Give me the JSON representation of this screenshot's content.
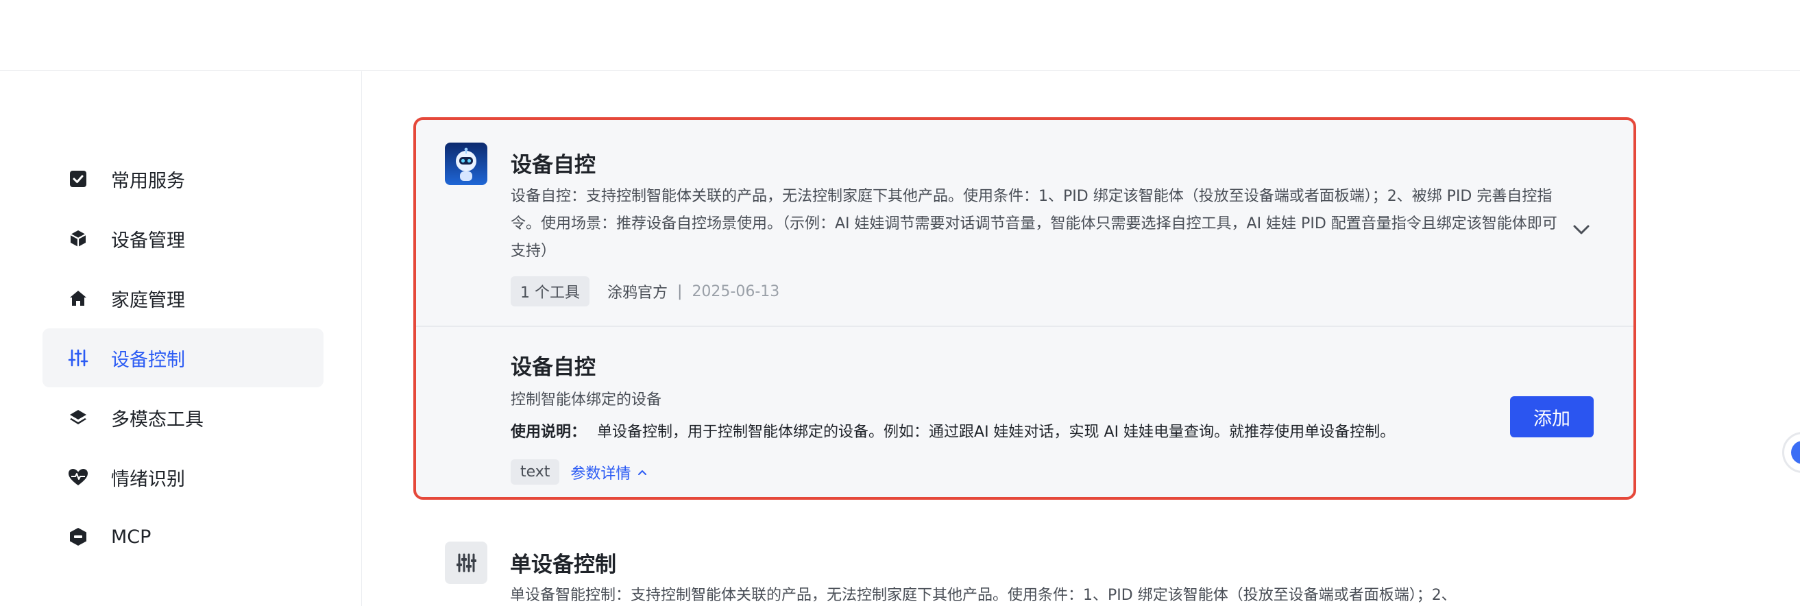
{
  "sidebar": {
    "items": [
      {
        "label": "常用服务",
        "icon": "checkbox-icon"
      },
      {
        "label": "设备管理",
        "icon": "cube-icon"
      },
      {
        "label": "家庭管理",
        "icon": "home-icon"
      },
      {
        "label": "设备控制",
        "icon": "sliders-icon",
        "active": true
      },
      {
        "label": "多模态工具",
        "icon": "layers-icon"
      },
      {
        "label": "情绪识别",
        "icon": "heart-pulse-icon"
      },
      {
        "label": "MCP",
        "icon": "mcp-icon"
      }
    ]
  },
  "card": {
    "title": "设备自控",
    "description": "设备自控：支持控制智能体关联的产品，无法控制家庭下其他产品。使用条件：1、PID 绑定该智能体（投放至设备端或者面板端）；2、被绑 PID 完善自控指令。使用场景：推荐设备自控场景使用。（示例：AI 娃娃调节需要对话调节音量，智能体只需要选择自控工具，AI 娃娃 PID 配置音量指令且绑定该智能体即可支持）",
    "tool_count": "1 个工具",
    "author": "涂鸦官方",
    "separator": "|",
    "date": "2025-06-13",
    "tool": {
      "name": "设备自控",
      "subtitle": "控制智能体绑定的设备",
      "usage_label": "使用说明：",
      "usage_text": "单设备控制，用于控制智能体绑定的设备。例如：通过跟AI 娃娃对话，实现 AI 娃娃电量查询。就推荐使用单设备控制。",
      "type_tag": "text",
      "param_link": "参数详情",
      "add_button": "添加"
    }
  },
  "next_card": {
    "title": "单设备控制",
    "description": "单设备智能控制：支持控制智能体关联的产品，无法控制家庭下其他产品。使用条件：1、PID 绑定该智能体（投放至设备端或者面板端）；2、"
  },
  "colors": {
    "accent": "#2b5bf4",
    "highlight_border": "#e5483a",
    "button": "#2b55f0"
  }
}
